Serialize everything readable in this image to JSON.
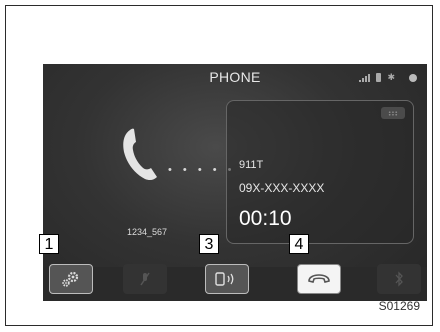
{
  "screen": {
    "title": "PHONE",
    "device_name": "1234_567",
    "dots": "• • • • •"
  },
  "call": {
    "contact_name": "911T",
    "number": "09X-XXX-XXXX",
    "timer": "00:10"
  },
  "callouts": [
    "1",
    "3",
    "4"
  ],
  "figure_code": "S01269",
  "icons": {
    "settings": "gear-icon",
    "mute": "mute-icon",
    "handsfree": "phone-speaker-icon",
    "end_call": "end-call-icon",
    "bluetooth": "bluetooth-icon"
  },
  "colors": {
    "screen_bg": "#333333",
    "end_call_button": "#f4f4f4"
  }
}
